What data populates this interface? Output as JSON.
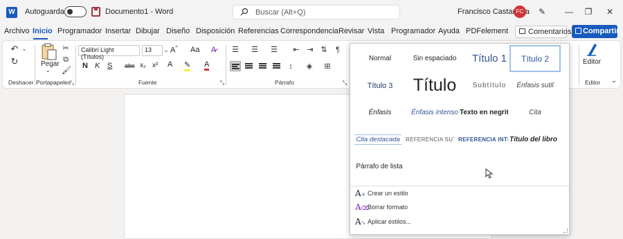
{
  "titlebar": {
    "autosave_label": "Autoguardado",
    "doc_title": "Documento1  -  Word",
    "search_placeholder": "Buscar (Alt+Q)",
    "user_name": "Francisco Castaneda",
    "avatar_initials": "FC"
  },
  "tabs": [
    "Archivo",
    "Inicio",
    "Programador",
    "Insertar",
    "Dibujar",
    "Diseño",
    "Disposición",
    "Referencias",
    "Correspondencia",
    "Revisar",
    "Vista",
    "Programador",
    "Ayuda",
    "PDFelement"
  ],
  "active_tab": "Inicio",
  "header_buttons": {
    "comments": "Comentarios",
    "share": "Compartir"
  },
  "ribbon": {
    "undo_label": "Deshacer",
    "clipboard_label": "Portapapeles",
    "paste_label": "Pegar",
    "font_group_label": "Fuente",
    "paragraph_group_label": "Párrafo",
    "editor_group_label": "Editor",
    "editor_button": "Editor",
    "font_name": "Calibri Light (Títulos)",
    "font_size": "13",
    "bold": "N",
    "italic": "K",
    "underline": "S",
    "strike": "abc",
    "subscript": "x₂",
    "superscript": "x²",
    "aa": "Aa"
  },
  "styles_panel": {
    "rows": [
      [
        "Normal",
        "Sin espaciado",
        "Título 1",
        "Título 2"
      ],
      [
        "Título 3",
        "Título",
        "Subtítulo",
        "Énfasis sutil"
      ],
      [
        "Énfasis",
        "Énfasis intenso",
        "Texto en negrita",
        "Cita"
      ],
      [
        "Cita destacada",
        "Referencia sutil",
        "Referencia inte",
        "Título del libro"
      ],
      [
        "Párrafo de lista"
      ]
    ],
    "selected": "Título 2",
    "actions": [
      "Crear un estilo",
      "Borrar formato",
      "Aplicar estilos..."
    ]
  },
  "colors": {
    "accent": "#185abd",
    "avatar": "#d13438",
    "heading_blue": "#2f5597"
  }
}
